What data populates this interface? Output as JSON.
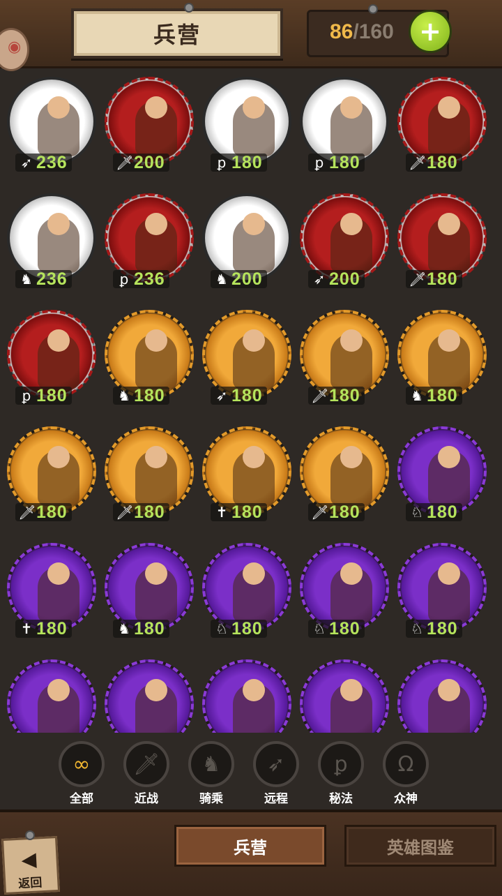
{
  "header": {
    "title": "兵营",
    "count_current": "86",
    "count_separator": "/",
    "count_max": "160",
    "add_label": "+"
  },
  "units": [
    {
      "tier": "white",
      "type": "ranged-bow-icon",
      "glyph": "➶",
      "value": "236"
    },
    {
      "tier": "red",
      "type": "melee-sword-icon",
      "glyph": "🗡",
      "value": "200"
    },
    {
      "tier": "white",
      "type": "magic-scroll-icon",
      "glyph": "ꝑ",
      "value": "180"
    },
    {
      "tier": "white",
      "type": "magic-scroll-icon",
      "glyph": "ꝑ",
      "value": "180"
    },
    {
      "tier": "red",
      "type": "melee-sword-icon",
      "glyph": "🗡",
      "value": "180"
    },
    {
      "tier": "white",
      "type": "mount-horse-icon",
      "glyph": "♞",
      "value": "236"
    },
    {
      "tier": "red",
      "type": "magic-scroll-icon",
      "glyph": "ꝑ",
      "value": "236"
    },
    {
      "tier": "white",
      "type": "mount-horse-icon",
      "glyph": "♞",
      "value": "200"
    },
    {
      "tier": "red",
      "type": "ranged-bow-icon",
      "glyph": "➶",
      "value": "200"
    },
    {
      "tier": "red",
      "type": "melee-sword-icon",
      "glyph": "🗡",
      "value": "180"
    },
    {
      "tier": "red",
      "type": "magic-scroll-icon",
      "glyph": "ꝑ",
      "value": "180"
    },
    {
      "tier": "orange",
      "type": "mount-horse-icon",
      "glyph": "♞",
      "value": "180"
    },
    {
      "tier": "orange",
      "type": "ranged-bow-icon",
      "glyph": "➶",
      "value": "180"
    },
    {
      "tier": "orange",
      "type": "melee-sword-icon",
      "glyph": "🗡",
      "value": "180"
    },
    {
      "tier": "orange",
      "type": "mount-horse-icon",
      "glyph": "♞",
      "value": "180"
    },
    {
      "tier": "orange",
      "type": "melee-sword-icon",
      "glyph": "🗡",
      "value": "180"
    },
    {
      "tier": "orange",
      "type": "melee-sword-icon",
      "glyph": "🗡",
      "value": "180"
    },
    {
      "tier": "orange",
      "type": "holy-cross-icon",
      "glyph": "✝",
      "value": "180"
    },
    {
      "tier": "orange",
      "type": "melee-sword-icon",
      "glyph": "🗡",
      "value": "180"
    },
    {
      "tier": "purple",
      "type": "mount-divine-icon",
      "glyph": "♘",
      "value": "180"
    },
    {
      "tier": "purple",
      "type": "holy-cross-icon",
      "glyph": "✝",
      "value": "180"
    },
    {
      "tier": "purple",
      "type": "mount-horse-icon",
      "glyph": "♞",
      "value": "180"
    },
    {
      "tier": "purple",
      "type": "mount-divine-icon",
      "glyph": "♘",
      "value": "180"
    },
    {
      "tier": "purple",
      "type": "mount-divine-icon",
      "glyph": "♘",
      "value": "180"
    },
    {
      "tier": "purple",
      "type": "mount-divine-icon",
      "glyph": "♘",
      "value": "180"
    },
    {
      "tier": "purple",
      "type": "",
      "glyph": "",
      "value": ""
    },
    {
      "tier": "purple",
      "type": "",
      "glyph": "",
      "value": ""
    },
    {
      "tier": "purple",
      "type": "",
      "glyph": "",
      "value": ""
    },
    {
      "tier": "purple",
      "type": "",
      "glyph": "",
      "value": ""
    },
    {
      "tier": "purple",
      "type": "",
      "glyph": "",
      "value": ""
    }
  ],
  "filters": [
    {
      "id": "all",
      "icon": "infinity-icon",
      "glyph": "∞",
      "label": "全部",
      "active": true
    },
    {
      "id": "melee",
      "icon": "sword-icon",
      "glyph": "🗡",
      "label": "近战",
      "active": false
    },
    {
      "id": "mount",
      "icon": "horse-icon",
      "glyph": "♞",
      "label": "骑乘",
      "active": false
    },
    {
      "id": "ranged",
      "icon": "bow-icon",
      "glyph": "➶",
      "label": "远程",
      "active": false
    },
    {
      "id": "magic",
      "icon": "scroll-icon",
      "glyph": "ꝑ",
      "label": "秘法",
      "active": false
    },
    {
      "id": "gods",
      "icon": "omega-icon",
      "glyph": "Ω",
      "label": "众神",
      "active": false
    }
  ],
  "bottom": {
    "back_label": "返回",
    "back_glyph": "◀",
    "tab_barracks": "兵营",
    "tab_heroes": "英雄图鉴"
  }
}
